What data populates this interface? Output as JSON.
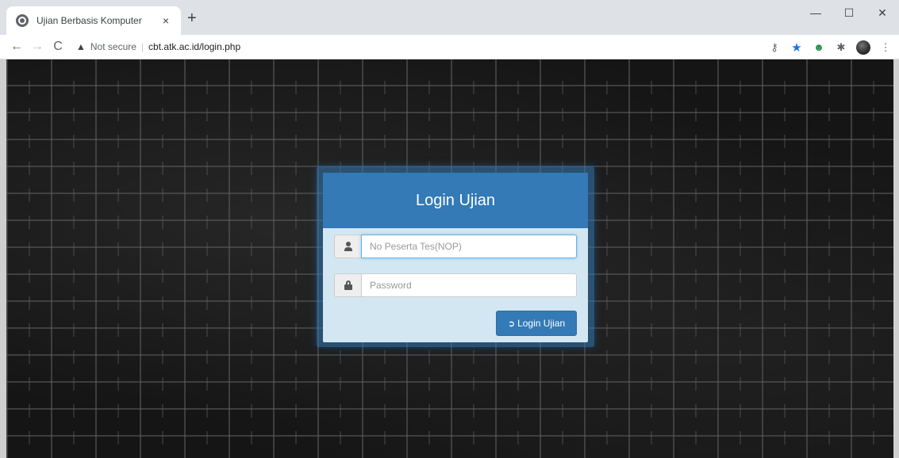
{
  "browser": {
    "tab": {
      "title": "Ujian Berbasis Komputer",
      "favicon": "globe-icon",
      "close_label": "×"
    },
    "new_tab_label": "+",
    "window_controls": {
      "minimize": "—",
      "maximize": "☐",
      "close": "✕"
    },
    "nav": {
      "back": "←",
      "forward": "→",
      "reload": "C"
    },
    "omnibox": {
      "security_icon": "warning-icon",
      "security_label": "Not secure",
      "separator": "|",
      "url": "cbt.atk.ac.id/login.php"
    },
    "toolbar_icons": [
      "key-icon",
      "star-icon",
      "profile-icon",
      "puzzle-icon",
      "avatar-icon",
      "menu-icon"
    ]
  },
  "page": {
    "background": "dark-brick-wall",
    "login": {
      "title": "Login Ujian",
      "username_placeholder": "No Peserta Tes(NOP)",
      "password_placeholder": "Password",
      "submit_label": "Login Ujian",
      "submit_icon": "login-icon"
    }
  },
  "colors": {
    "accent": "#337ab7",
    "panel_body": "#d3e7f3",
    "input_focus": "#66afe9"
  }
}
